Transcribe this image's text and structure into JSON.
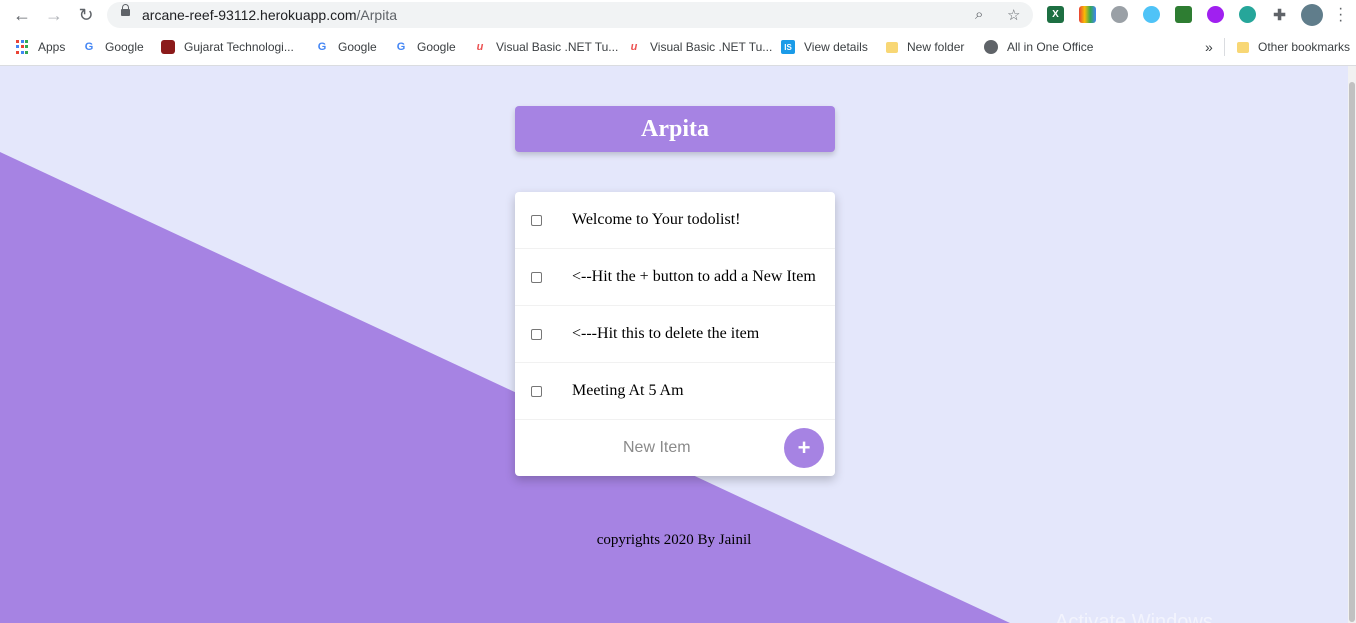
{
  "browser": {
    "url_host": "arcane-reef-93112.herokuapp.com",
    "url_path": "/Arpita",
    "bookmarks": [
      {
        "label": "Apps",
        "icon": "apps-icon"
      },
      {
        "label": "Google",
        "icon": "google-icon"
      },
      {
        "label": "Gujarat Technologi...",
        "icon": "gtu-icon"
      },
      {
        "label": "Google",
        "icon": "google-icon"
      },
      {
        "label": "Google",
        "icon": "google-icon"
      },
      {
        "label": "Visual Basic .NET Tu...",
        "icon": "udemy-icon"
      },
      {
        "label": "Visual Basic .NET Tu...",
        "icon": "udemy-icon"
      },
      {
        "label": "View details",
        "icon": "is-icon"
      },
      {
        "label": "New folder",
        "icon": "folder-icon"
      },
      {
        "label": "All in One Office",
        "icon": "globe-icon"
      }
    ],
    "overflow_label": "»",
    "other_bookmarks": "Other bookmarks"
  },
  "app": {
    "title": "Arpita",
    "items": [
      {
        "text": "Welcome to Your todolist!",
        "checked": false
      },
      {
        "text": "<--Hit the + button to add a New Item",
        "checked": false
      },
      {
        "text": "<---Hit this to delete the item",
        "checked": false
      },
      {
        "text": "Meeting At 5 Am",
        "checked": false
      }
    ],
    "new_item_placeholder": "New Item",
    "add_button_label": "+",
    "footer": "copyrights 2020 By Jainil"
  },
  "watermark": "Activate Windows",
  "colors": {
    "accent": "#a683e3",
    "background": "#e4e7fb"
  }
}
